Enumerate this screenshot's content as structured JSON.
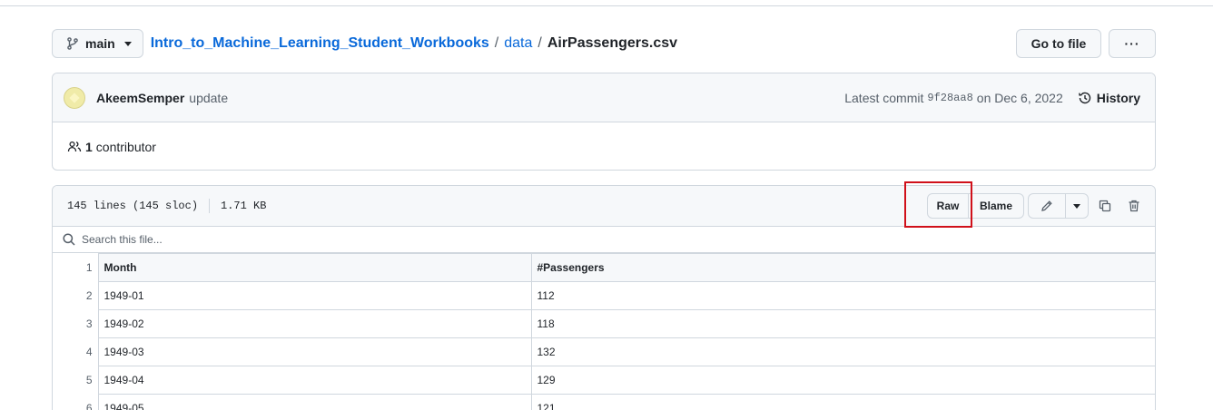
{
  "breadcrumb": {
    "branch": "main",
    "repo": "Intro_to_Machine_Learning_Student_Workbooks",
    "folder": "data",
    "file": "AirPassengers.csv",
    "goto_label": "Go to file",
    "more_label": "···"
  },
  "commit": {
    "author": "AkeemSemper",
    "message": "update",
    "latest_label": "Latest commit",
    "sha": "9f28aa8",
    "date": "on Dec 6, 2022",
    "history_label": "History",
    "contributors_count": "1",
    "contributors_label": "contributor"
  },
  "file": {
    "lines": "145 lines (145 sloc)",
    "size": "1.71 KB",
    "raw_label": "Raw",
    "blame_label": "Blame",
    "search_placeholder": "Search this file..."
  },
  "table": {
    "headers": [
      "Month",
      "#Passengers"
    ],
    "rows": [
      {
        "line": "1",
        "cells": [
          "Month",
          "#Passengers"
        ]
      },
      {
        "line": "2",
        "cells": [
          "1949-01",
          "112"
        ]
      },
      {
        "line": "3",
        "cells": [
          "1949-02",
          "118"
        ]
      },
      {
        "line": "4",
        "cells": [
          "1949-03",
          "132"
        ]
      },
      {
        "line": "5",
        "cells": [
          "1949-04",
          "129"
        ]
      },
      {
        "line": "6",
        "cells": [
          "1949-05",
          "121"
        ]
      }
    ]
  }
}
